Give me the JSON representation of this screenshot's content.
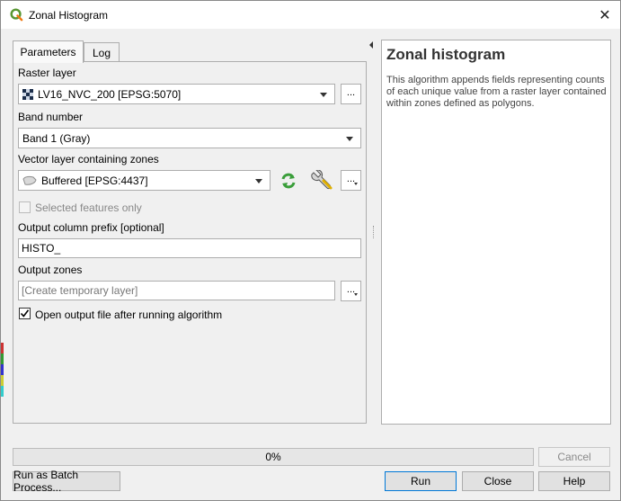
{
  "window": {
    "title": "Zonal Histogram",
    "close_symbol": "✕"
  },
  "tabs": [
    {
      "label": "Parameters",
      "active": true
    },
    {
      "label": "Log",
      "active": false
    }
  ],
  "params": {
    "raster_layer": {
      "label": "Raster layer",
      "value": "LV16_NVC_200 [EPSG:5070]",
      "icon": "raster-layer-icon"
    },
    "band_number": {
      "label": "Band number",
      "value": "Band 1 (Gray)"
    },
    "vector_layer": {
      "label": "Vector layer containing zones",
      "value": "Buffered [EPSG:4437]",
      "icon": "polygon-layer-icon"
    },
    "selected_only": {
      "label": "Selected features only",
      "checked": false,
      "enabled": false
    },
    "prefix": {
      "label": "Output column prefix [optional]",
      "value": "HISTO_"
    },
    "output_zones": {
      "label": "Output zones",
      "placeholder": "[Create temporary layer]"
    },
    "open_output": {
      "label": "Open output file after running algorithm",
      "checked": true
    },
    "browse_label": "..."
  },
  "help": {
    "title": "Zonal histogram",
    "body": "This algorithm appends fields representing counts of each unique value from a raster layer contained within zones defined as polygons."
  },
  "progress": {
    "value": 0,
    "text": "0%"
  },
  "buttons": {
    "cancel": "Cancel",
    "batch": "Run as Batch Process...",
    "run": "Run",
    "close": "Close",
    "help": "Help"
  },
  "colors": {
    "accent": "#0078d7",
    "qgis_green": "#589632",
    "refresh_green": "#3a9e3a",
    "progress": "#06b025"
  }
}
